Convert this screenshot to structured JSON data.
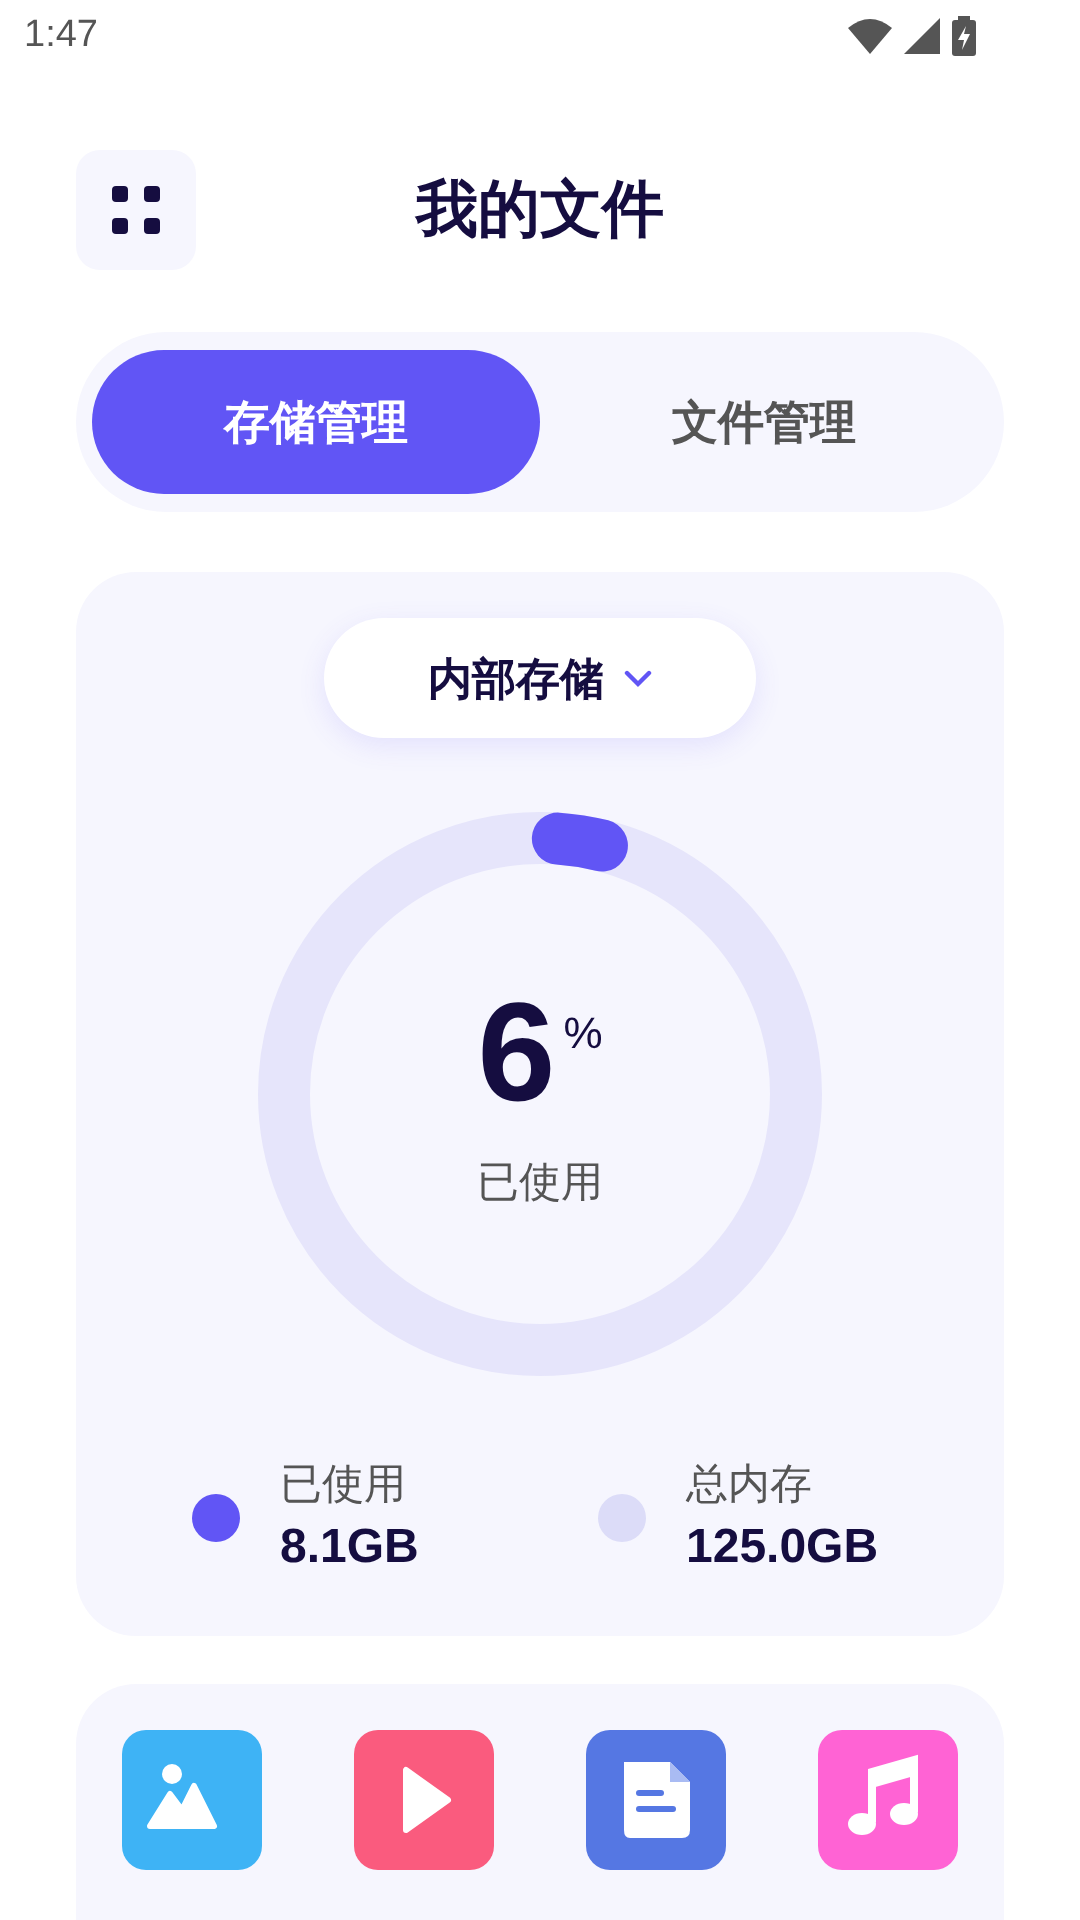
{
  "status_bar": {
    "time": "1:47"
  },
  "header": {
    "title": "我的文件"
  },
  "tabs": [
    {
      "label": "存储管理",
      "selected": true
    },
    {
      "label": "文件管理",
      "selected": false
    }
  ],
  "storage": {
    "selector": "内部存储",
    "percent": "6",
    "percent_sign": "%",
    "caption": "已使用",
    "legend": [
      {
        "label": "已使用",
        "value": "8.1GB",
        "color": "#6155f5"
      },
      {
        "label": "总内存",
        "value": "125.0GB",
        "color": "#dcdcf8"
      }
    ]
  },
  "categories": [
    {
      "kind": "image"
    },
    {
      "kind": "video"
    },
    {
      "kind": "document"
    },
    {
      "kind": "audio"
    }
  ]
}
